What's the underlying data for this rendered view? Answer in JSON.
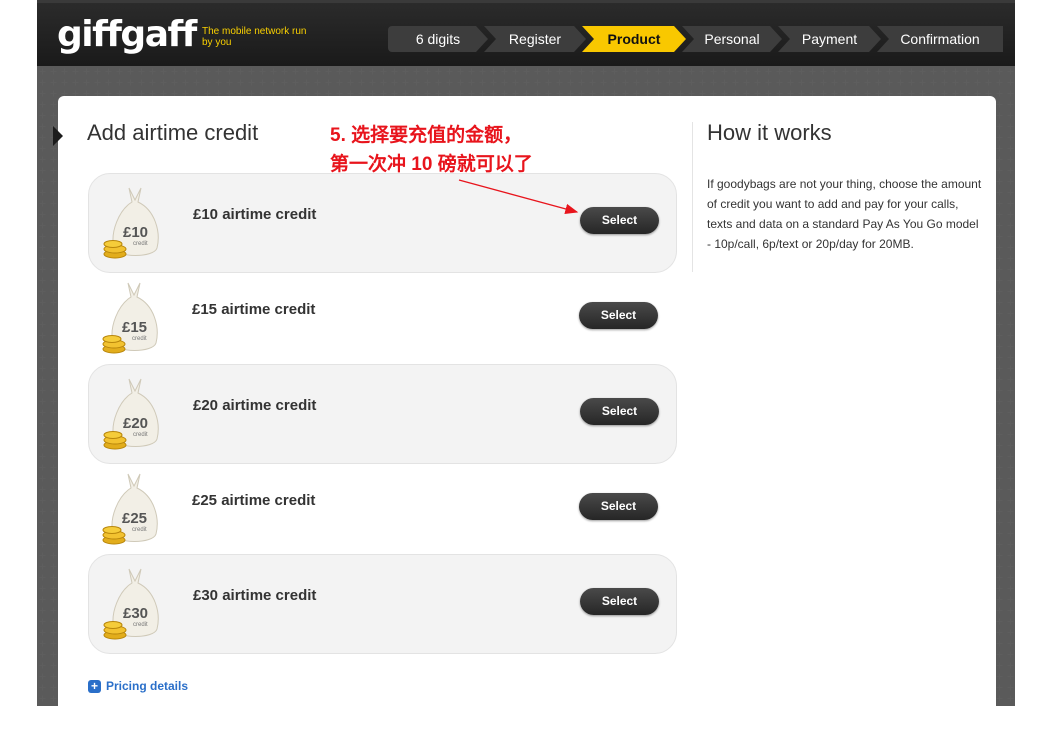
{
  "header": {
    "logo": "giffgaff",
    "tagline": "The mobile network run by you",
    "steps": [
      {
        "label": "6 digits",
        "active": false
      },
      {
        "label": "Register",
        "active": false
      },
      {
        "label": "Product",
        "active": true
      },
      {
        "label": "Personal",
        "active": false
      },
      {
        "label": "Payment",
        "active": false
      },
      {
        "label": "Confirmation",
        "active": false
      }
    ]
  },
  "main": {
    "title": "Add airtime credit",
    "options": [
      {
        "label": "£10 airtime credit",
        "bag_amount": "£10",
        "bag_sub": "credit",
        "button": "Select"
      },
      {
        "label": "£15 airtime credit",
        "bag_amount": "£15",
        "bag_sub": "credit",
        "button": "Select"
      },
      {
        "label": "£20 airtime credit",
        "bag_amount": "£20",
        "bag_sub": "credit",
        "button": "Select"
      },
      {
        "label": "£25 airtime credit",
        "bag_amount": "£25",
        "bag_sub": "credit",
        "button": "Select"
      },
      {
        "label": "£30 airtime credit",
        "bag_amount": "£30",
        "bag_sub": "credit",
        "button": "Select"
      }
    ],
    "pricing_link": "Pricing details"
  },
  "sidebar": {
    "title": "How it works",
    "text": "If goodybags are not your thing, choose the amount of credit you want to add and pay for your calls, texts and data on a standard Pay As You Go model - 10p/call, 6p/text or 20p/day for 20MB."
  },
  "annotation": {
    "line1": "5. 选择要充值的金额，",
    "line2": "第一次冲 10 磅就可以了"
  },
  "colors": {
    "brand_yellow": "#f9c800",
    "annotation_red": "#e8141c",
    "link_blue": "#2a6fc9"
  }
}
